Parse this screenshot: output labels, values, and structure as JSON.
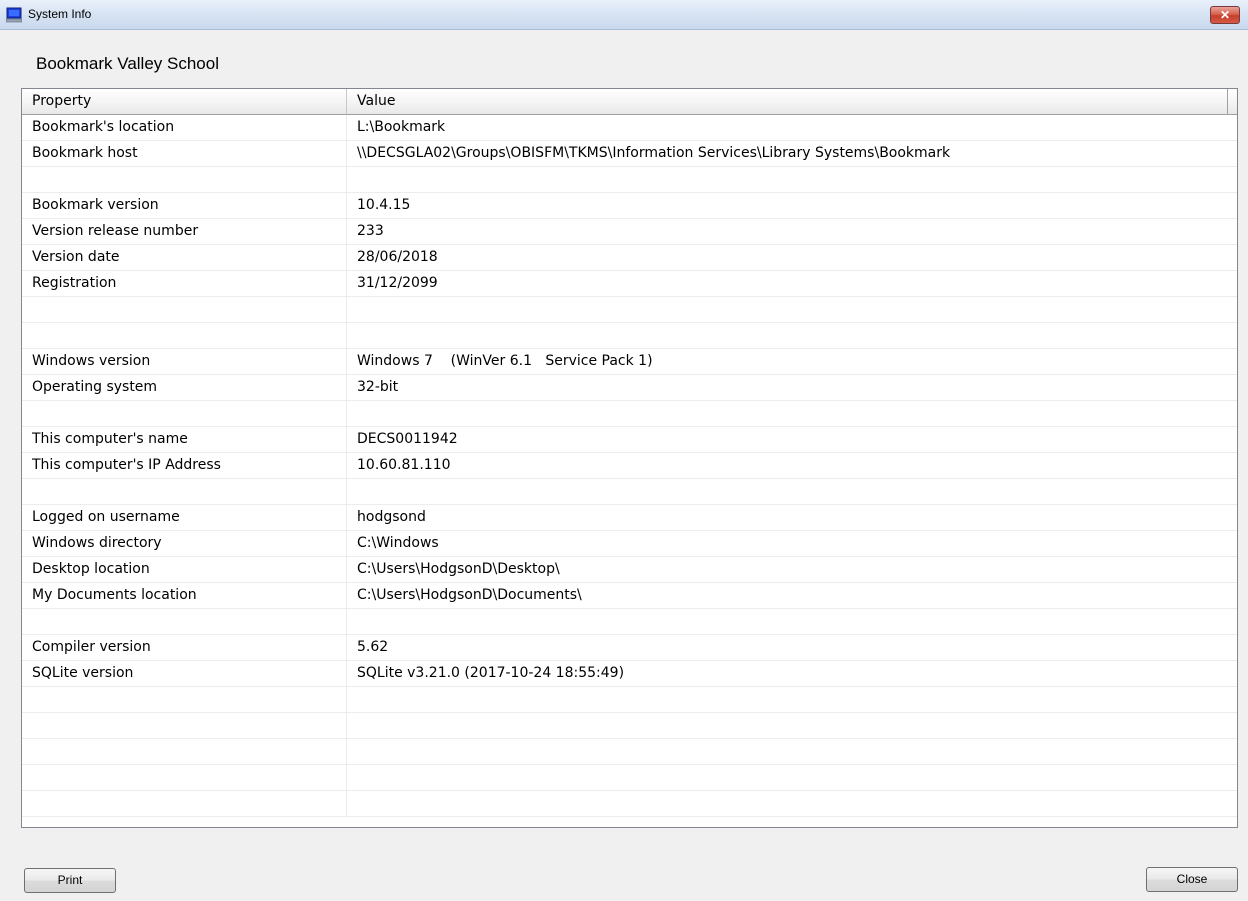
{
  "window": {
    "title": "System Info",
    "close_glyph": "✕",
    "icon": "computer-icon"
  },
  "heading": "Bookmark Valley School",
  "table": {
    "columns": [
      "Property",
      "Value"
    ],
    "rows": [
      [
        "Bookmark's location",
        "L:\\Bookmark"
      ],
      [
        "Bookmark host",
        "\\\\DECSGLA02\\Groups\\OBISFM\\TKMS\\Information Services\\Library Systems\\Bookmark"
      ],
      [
        "",
        ""
      ],
      [
        "Bookmark version",
        "10.4.15"
      ],
      [
        "Version release number",
        "233"
      ],
      [
        "Version date",
        "28/06/2018"
      ],
      [
        "Registration",
        "31/12/2099"
      ],
      [
        "",
        ""
      ],
      [
        "",
        ""
      ],
      [
        "Windows version",
        "Windows 7    (WinVer 6.1   Service Pack 1)"
      ],
      [
        "Operating system",
        "32-bit"
      ],
      [
        "",
        ""
      ],
      [
        "This computer's name",
        "DECS0011942"
      ],
      [
        "This computer's IP Address",
        "10.60.81.110"
      ],
      [
        "",
        ""
      ],
      [
        "Logged on username",
        "hodgsond"
      ],
      [
        "Windows directory",
        "C:\\Windows"
      ],
      [
        "Desktop location",
        "C:\\Users\\HodgsonD\\Desktop\\"
      ],
      [
        "My Documents location",
        "C:\\Users\\HodgsonD\\Documents\\"
      ],
      [
        "",
        ""
      ],
      [
        "Compiler version",
        "5.62"
      ],
      [
        "SQLite version",
        "SQLite v3.21.0 (2017-10-24 18:55:49)"
      ],
      [
        "",
        ""
      ],
      [
        "",
        ""
      ],
      [
        "",
        ""
      ],
      [
        "",
        ""
      ],
      [
        "",
        ""
      ]
    ]
  },
  "buttons": {
    "print": "Print",
    "close": "Close"
  }
}
